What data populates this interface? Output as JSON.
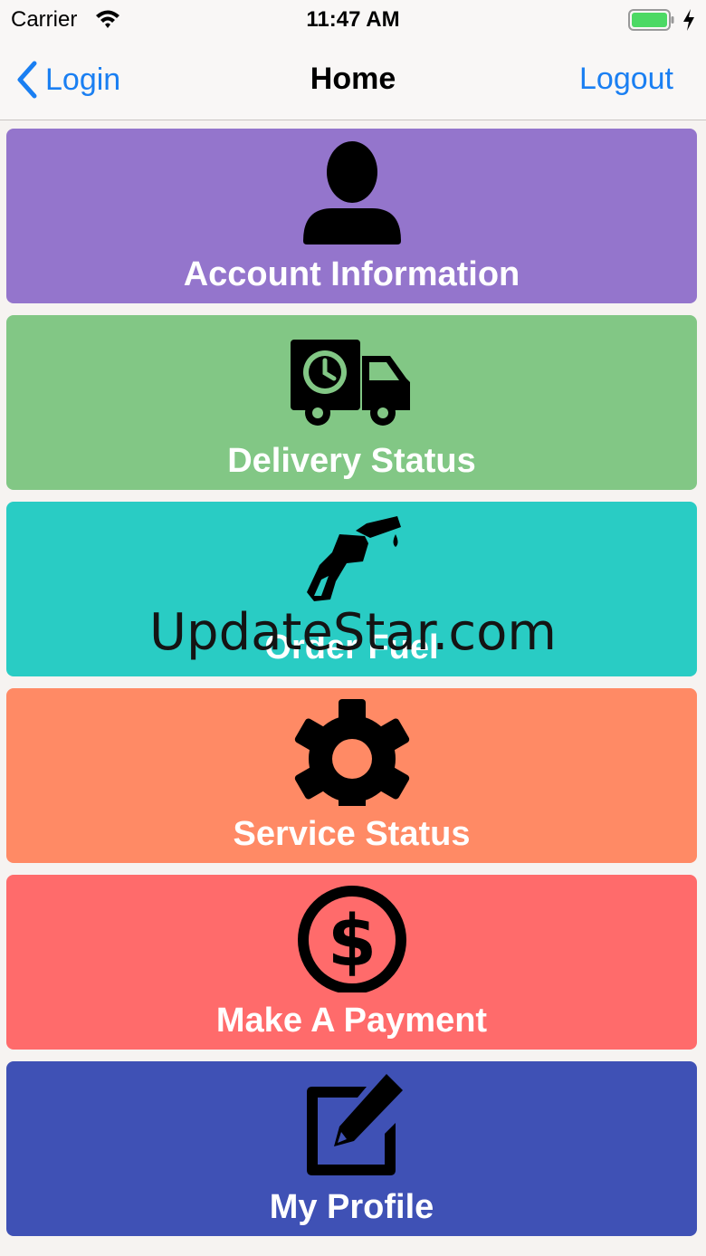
{
  "status_bar": {
    "carrier": "Carrier",
    "time": "11:47 AM",
    "battery_color": "#4cd964"
  },
  "nav": {
    "back_label": "Login",
    "title": "Home",
    "logout_label": "Logout",
    "tint": "#1a7ff2"
  },
  "menu": [
    {
      "label": "Account Information",
      "icon": "person-icon",
      "color": "#9475cc"
    },
    {
      "label": "Delivery Status",
      "icon": "delivery-truck-icon",
      "color": "#82c785"
    },
    {
      "label": "Order Fuel",
      "icon": "fuel-nozzle-icon",
      "color": "#29ccc4"
    },
    {
      "label": "Service Status",
      "icon": "gear-icon",
      "color": "#ff8a65"
    },
    {
      "label": "Make A Payment",
      "icon": "dollar-coin-icon",
      "color": "#ff6b6b"
    },
    {
      "label": "My Profile",
      "icon": "edit-icon",
      "color": "#3f51b5"
    }
  ],
  "watermark": "UpdateStar.com"
}
